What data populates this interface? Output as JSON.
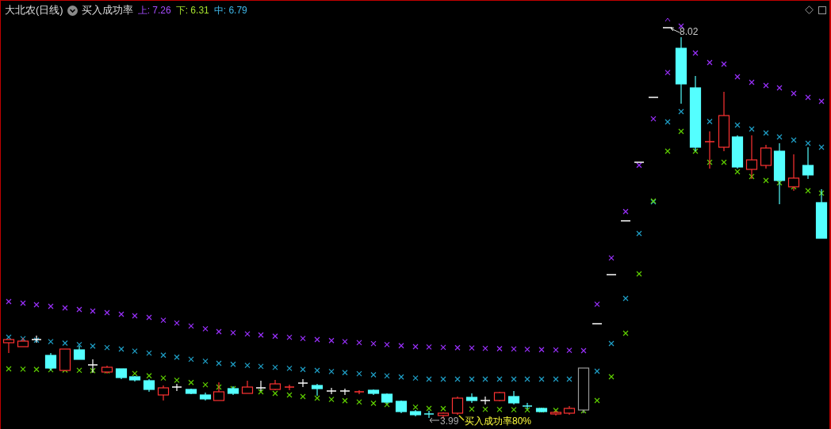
{
  "header": {
    "title": "大北农(日线)",
    "indicator": "买入成功率",
    "values": [
      {
        "label": "上:",
        "value": "7.26",
        "color": "#a64dff"
      },
      {
        "label": "下:",
        "value": "6.31",
        "color": "#a6e22e"
      },
      {
        "label": "中:",
        "value": "6.79",
        "color": "#3fb7e8"
      }
    ]
  },
  "chart_labels": {
    "high": "8.02",
    "low": "3.99",
    "signal": "买入成功率80%"
  }
}
